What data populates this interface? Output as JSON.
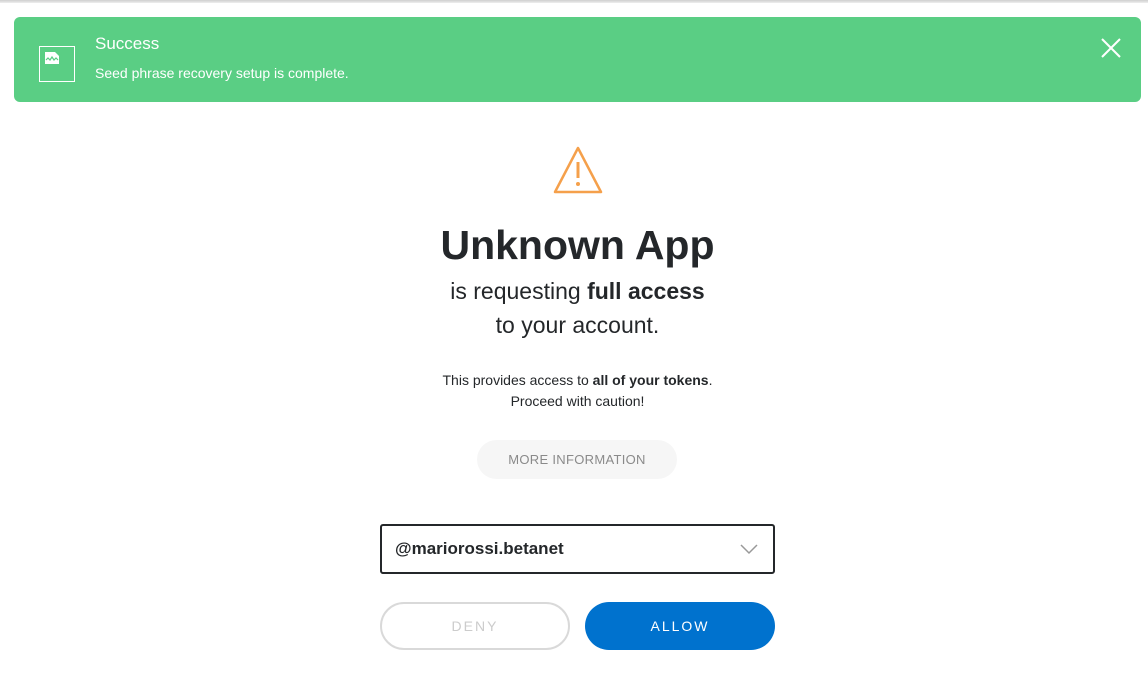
{
  "toast": {
    "title": "Success",
    "message": "Seed phrase recovery setup is complete.",
    "background_color": "#5ace84",
    "icon": "image-icon",
    "close_icon": "close-icon"
  },
  "warning": {
    "icon": "warning-triangle-icon",
    "color": "#f5a04b"
  },
  "request": {
    "app_name": "Unknown App",
    "line1_prefix": "is requesting ",
    "line1_strong": "full access",
    "line2": "to your account."
  },
  "info": {
    "line1_prefix": "This provides access to ",
    "line1_strong": "all of your tokens",
    "line1_suffix": ".",
    "line2": "Proceed with caution!"
  },
  "buttons": {
    "more_info": "MORE INFORMATION",
    "deny": "DENY",
    "allow": "ALLOW",
    "allow_color": "#0072ce"
  },
  "account_select": {
    "value": "@mariorossi.betanet",
    "icon": "chevron-down-icon"
  }
}
